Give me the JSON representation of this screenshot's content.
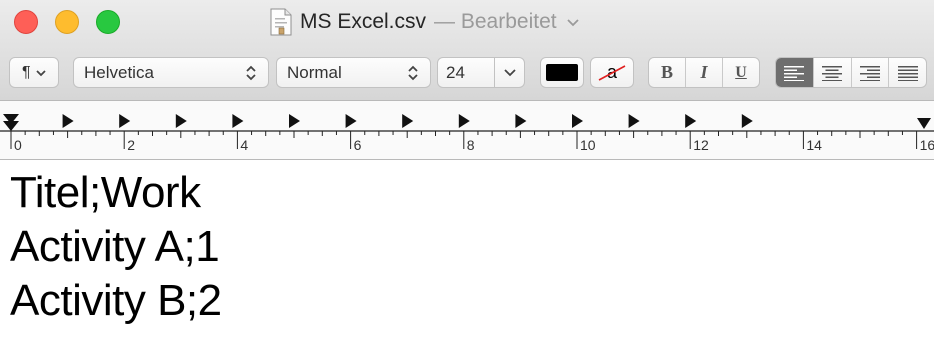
{
  "window": {
    "title": "MS Excel.csv",
    "edited_suffix": "— Bearbeitet",
    "icons": [
      "close-button",
      "minimize-button",
      "zoom-button",
      "document-icon",
      "chevron-down-icon"
    ]
  },
  "toolbar": {
    "paragraph_symbol": "¶",
    "font_family": "Helvetica",
    "font_style": "Normal",
    "font_size": "24",
    "background_color_glyph": "a",
    "bold": "B",
    "italic": "I",
    "underline": "U",
    "text_color": "#000000",
    "alignment_selected": "left"
  },
  "ruler": {
    "labels": [
      "0",
      "2",
      "4",
      "6",
      "8",
      "10",
      "12",
      "14",
      "16"
    ],
    "tab_stop_count": 13
  },
  "document": {
    "lines": [
      "Titel;Work",
      "Activity A;1",
      "Activity B;2"
    ]
  }
}
